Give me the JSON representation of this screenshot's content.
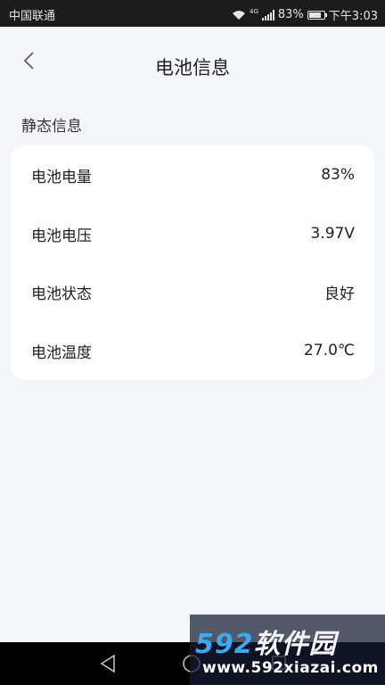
{
  "status_bar": {
    "carrier": "中国联通",
    "network": "4G",
    "battery_percent": "83%",
    "battery_level": 0.83,
    "time": "下午3:03"
  },
  "header": {
    "back_icon": "chevron-left-icon",
    "title": "电池信息"
  },
  "section": {
    "label": "静态信息"
  },
  "rows": [
    {
      "label": "电池电量",
      "value": "83%"
    },
    {
      "label": "电池电压",
      "value": "3.97V"
    },
    {
      "label": "电池状态",
      "value": "良好"
    },
    {
      "label": "电池温度",
      "value": "27.0℃"
    }
  ],
  "nav": {
    "back_icon": "triangle-back-icon",
    "home_icon": "circle-home-icon",
    "recent_icon": "square-recent-icon"
  },
  "watermark": {
    "logo_number": "592",
    "logo_text": "软件园",
    "url": "www.592xiazai.com"
  },
  "colors": {
    "background": "#f3f6fa",
    "card": "#ffffff",
    "status_bar": "#1c1c1c",
    "nav_bar": "#000000"
  }
}
